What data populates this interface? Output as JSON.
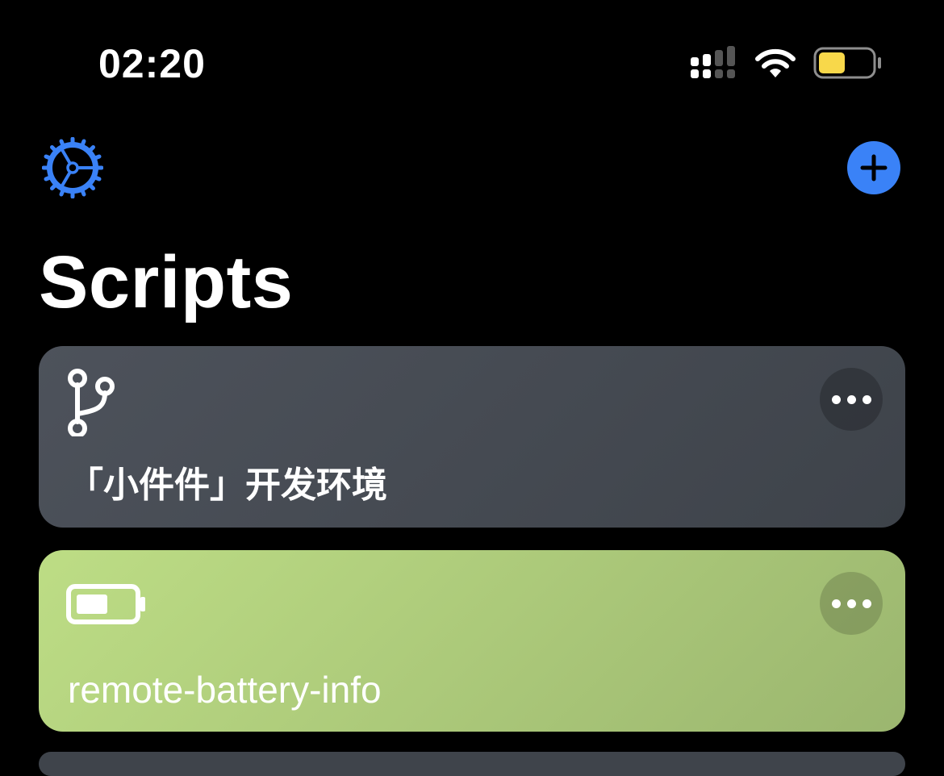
{
  "status_bar": {
    "time": "02:20",
    "signal_icon": "cellular-signal-icon",
    "wifi_icon": "wifi-icon",
    "battery_icon": "battery-icon",
    "battery_color": "#f8d84a"
  },
  "nav": {
    "settings_icon": "gear-icon",
    "add_icon": "plus-icon",
    "accent_color": "#3a82f7"
  },
  "page": {
    "title": "Scripts"
  },
  "scripts": [
    {
      "name": "「小件件」开发环境",
      "icon": "git-branch-icon",
      "color": "#4a4f57"
    },
    {
      "name": "remote-battery-info",
      "icon": "battery-icon",
      "color": "#b2d07d"
    }
  ]
}
